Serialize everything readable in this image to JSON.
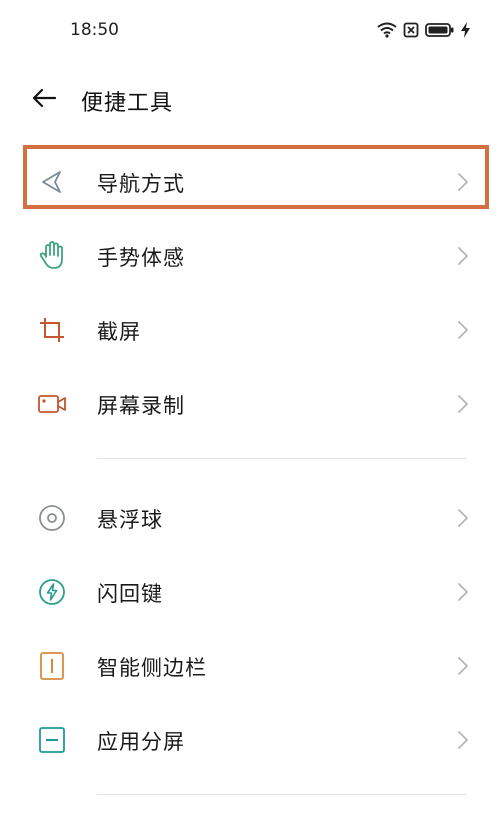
{
  "status_bar": {
    "time": "18:50",
    "icons": [
      "wifi-icon",
      "sim-blocked-icon",
      "battery-icon",
      "charging-bolt-icon"
    ]
  },
  "header": {
    "back_icon": "back-arrow-icon",
    "title": "便捷工具"
  },
  "sections": [
    {
      "items": [
        {
          "label": "导航方式",
          "icon": "navigation-icon",
          "color": "#7a8a9a",
          "highlighted": true
        },
        {
          "label": "手势体感",
          "icon": "hand-gesture-icon",
          "color": "#3aa57a"
        },
        {
          "label": "截屏",
          "icon": "crop-icon",
          "color": "#c2562e"
        },
        {
          "label": "屏幕录制",
          "icon": "video-record-icon",
          "color": "#c2562e"
        }
      ]
    },
    {
      "items": [
        {
          "label": "悬浮球",
          "icon": "floating-ball-icon",
          "color": "#8a8f96"
        },
        {
          "label": "闪回键",
          "icon": "flashback-icon",
          "color": "#2b9d8f"
        },
        {
          "label": "智能侧边栏",
          "icon": "sidebar-icon",
          "color": "#d88a3c"
        },
        {
          "label": "应用分屏",
          "icon": "split-screen-icon",
          "color": "#1f9a9a"
        }
      ]
    }
  ],
  "colors": {
    "highlight_border": "#d2713f",
    "divider": "#e3e3e3",
    "chevron": "#b5b5b5"
  }
}
